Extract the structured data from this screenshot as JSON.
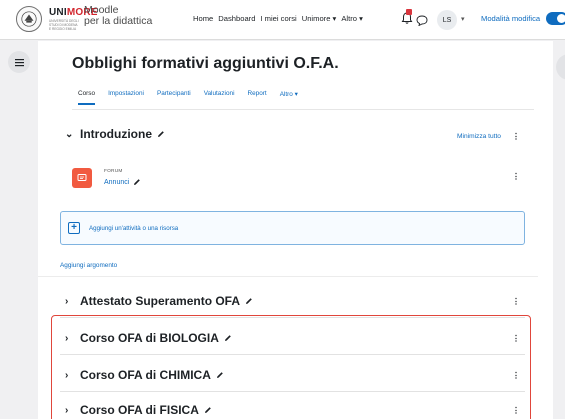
{
  "navbar": {
    "brand_uni": "UNI",
    "brand_more": "MORE",
    "brand_sub": "UNIVERSITÀ DEGLI STUDI DI MODENA E REGGIO EMILIA",
    "brand_moodle_1": "Moodle",
    "brand_moodle_2": "per la didattica",
    "links": [
      "Home",
      "Dashboard",
      "I miei corsi",
      "Unimore ▾",
      "Altro ▾"
    ],
    "avatar_initials": "LS",
    "edit_mode_label": "Modalità modifica",
    "accent": "#0f6cbf"
  },
  "course": {
    "title": "Obblighi formativi aggiuntivi O.F.A.",
    "tabs": [
      "Corso",
      "Impostazioni",
      "Partecipanti",
      "Valutazioni",
      "Report",
      "Altro ▾"
    ],
    "active_tab": "Corso"
  },
  "intro": {
    "title": "Introduzione",
    "minimize_label": "Minimizza tutto",
    "forum_type": "FORUM",
    "forum_name": "Annunci",
    "add_activity_label": "Aggiungi un'attività o una risorsa"
  },
  "add_topic_label": "Aggiungi argomento",
  "sections": [
    {
      "title": "Attestato Superamento OFA"
    },
    {
      "title": "Corso OFA di BIOLOGIA"
    },
    {
      "title": "Corso OFA di CHIMICA"
    },
    {
      "title": "Corso OFA di FISICA"
    }
  ],
  "colors": {
    "highlight": "#e0463b",
    "forum_icon": "#f15a40",
    "link": "#0f6cbf"
  }
}
